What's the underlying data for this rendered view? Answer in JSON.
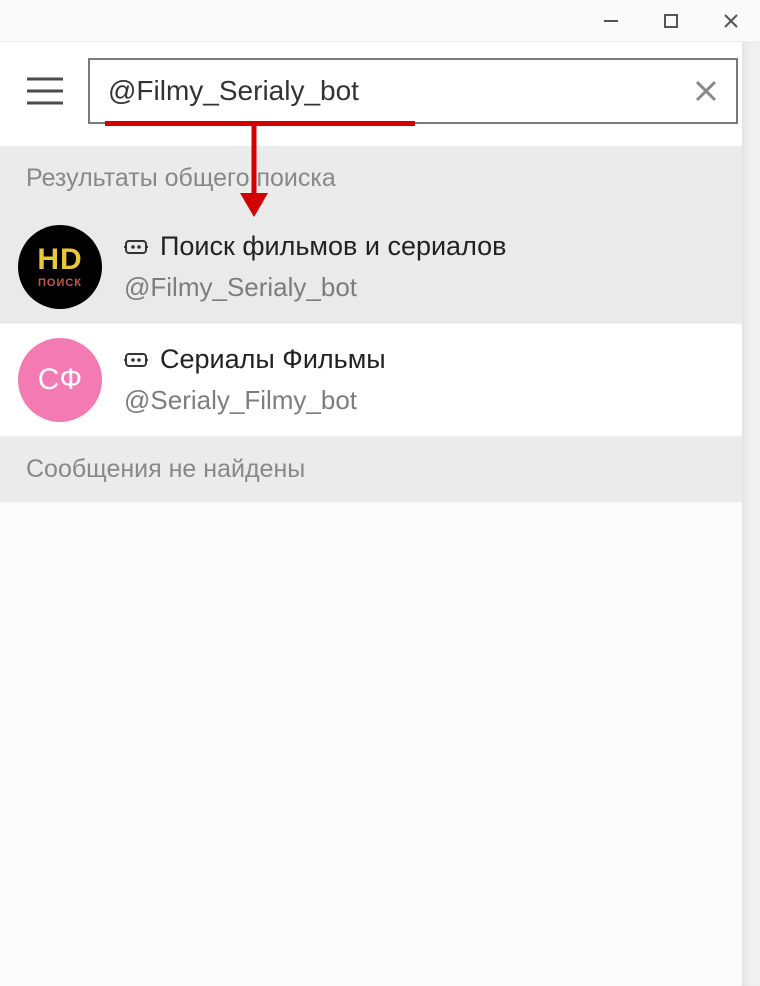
{
  "search": {
    "value": "@Filmy_Serialy_bot"
  },
  "sections": {
    "global_results_header": "Результаты общего поиска",
    "no_messages": "Сообщения не найдены"
  },
  "results": [
    {
      "avatar_top": "HD",
      "avatar_bottom": "ПОИСК",
      "title": "Поиск фильмов и сериалов",
      "username": "@Filmy_Serialy_bot"
    },
    {
      "avatar_label": "СФ",
      "title": "Сериалы Фильмы",
      "username": "@Serialy_Filmy_bot"
    }
  ]
}
